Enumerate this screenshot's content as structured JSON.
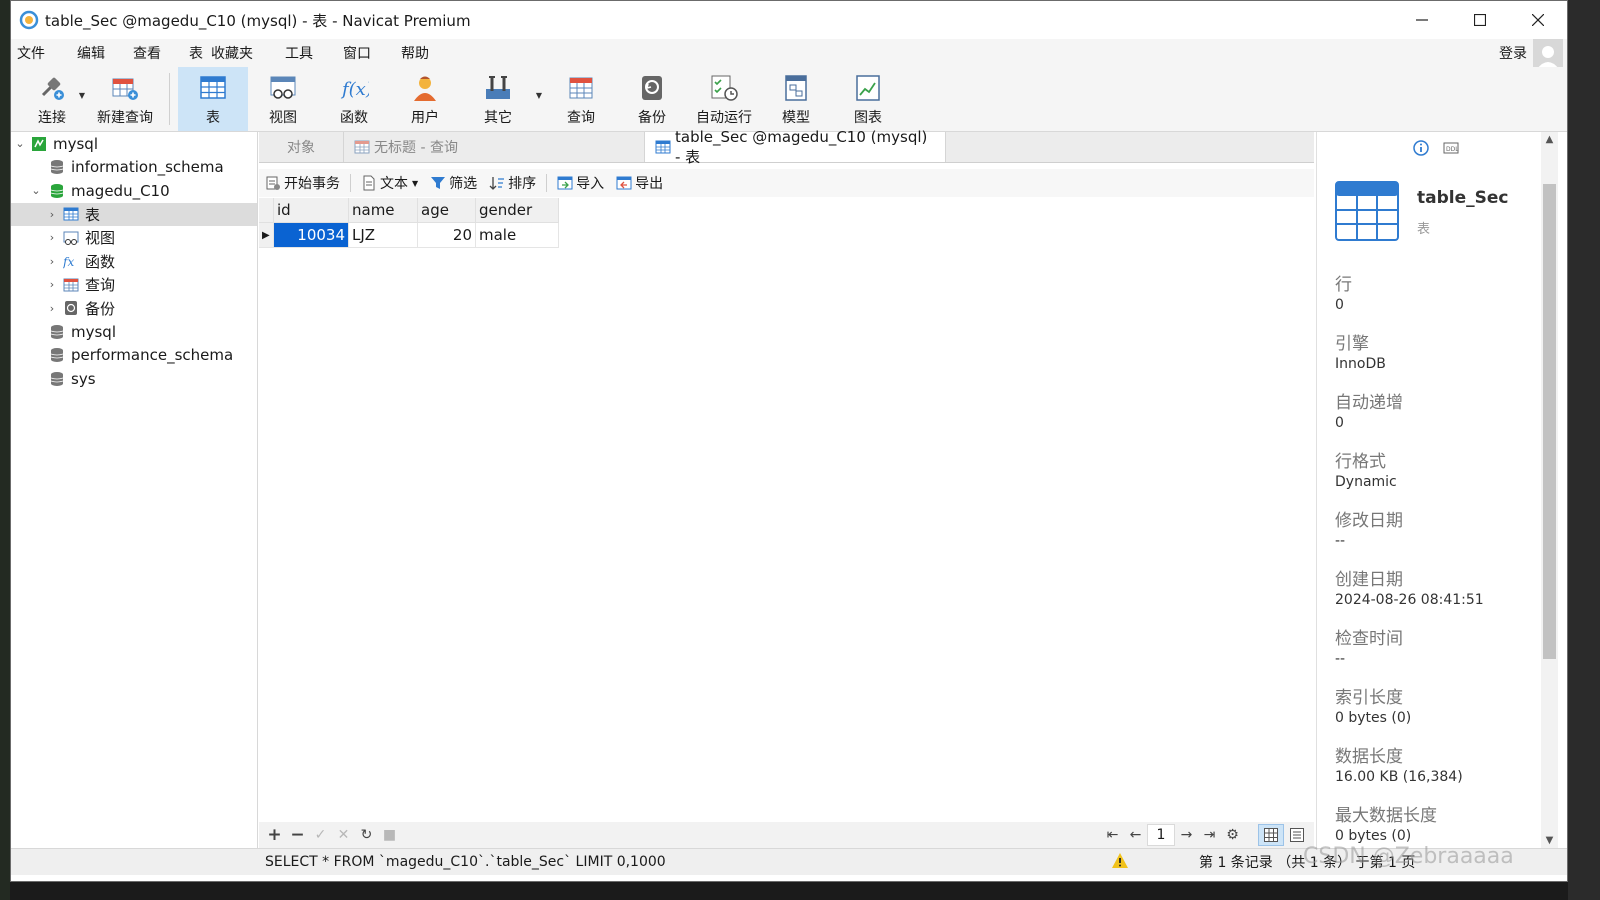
{
  "window": {
    "title": "table_Sec @magedu_C10 (mysql) - 表 - Navicat Premium"
  },
  "menu": [
    "文件",
    "编辑",
    "查看",
    "表",
    "收藏夹",
    "工具",
    "窗口",
    "帮助"
  ],
  "login_label": "登录",
  "toolbar": [
    {
      "label": "连接",
      "icon": "connection-icon"
    },
    {
      "label": "新建查询",
      "icon": "new-query-icon"
    },
    {
      "label": "表",
      "icon": "table-icon"
    },
    {
      "label": "视图",
      "icon": "view-icon"
    },
    {
      "label": "函数",
      "icon": "function-icon"
    },
    {
      "label": "用户",
      "icon": "user-icon"
    },
    {
      "label": "其它",
      "icon": "tools-icon"
    },
    {
      "label": "查询",
      "icon": "query-icon"
    },
    {
      "label": "备份",
      "icon": "backup-icon"
    },
    {
      "label": "自动运行",
      "icon": "automation-icon"
    },
    {
      "label": "模型",
      "icon": "model-icon"
    },
    {
      "label": "图表",
      "icon": "chart-icon"
    }
  ],
  "tree": {
    "connection": "mysql",
    "databases": {
      "information_schema": "information_schema",
      "magedu": "magedu_C10",
      "mysql": "mysql",
      "performance_schema": "performance_schema",
      "sys": "sys"
    },
    "children": {
      "tables": "表",
      "views": "视图",
      "functions": "函数",
      "queries": "查询",
      "backups": "备份"
    }
  },
  "tabs": {
    "objects": "对象",
    "query": "无标题 - 查询",
    "table": "table_Sec @magedu_C10 (mysql) - 表"
  },
  "data_toolbar": {
    "begin_transaction": "开始事务",
    "text": "文本",
    "filter": "筛选",
    "sort": "排序",
    "import": "导入",
    "export": "导出"
  },
  "grid": {
    "columns": [
      "id",
      "name",
      "age",
      "gender"
    ],
    "rows": [
      {
        "id": "10034",
        "name": "LJZ",
        "age": "20",
        "gender": "male"
      }
    ]
  },
  "pagination": {
    "page": "1"
  },
  "status": {
    "sql": "SELECT * FROM `magedu_C10`.`table_Sec` LIMIT 0,1000",
    "records": "第 1 条记录 （共 1 条） 于第 1 页"
  },
  "info_panel": {
    "name": "table_Sec",
    "type": "表",
    "properties": [
      {
        "label": "行",
        "value": "0"
      },
      {
        "label": "引擎",
        "value": "InnoDB"
      },
      {
        "label": "自动递增",
        "value": "0"
      },
      {
        "label": "行格式",
        "value": "Dynamic"
      },
      {
        "label": "修改日期",
        "value": "--"
      },
      {
        "label": "创建日期",
        "value": "2024-08-26 08:41:51"
      },
      {
        "label": "检查时间",
        "value": "--"
      },
      {
        "label": "索引长度",
        "value": "0 bytes (0)"
      },
      {
        "label": "数据长度",
        "value": "16.00 KB (16,384)"
      },
      {
        "label": "最大数据长度",
        "value": "0 bytes (0)"
      }
    ]
  },
  "watermark": "CSDN @Zebraaaaa",
  "colors": {
    "selection": "#0a63d2",
    "active_tool": "#cde4f7",
    "db_green": "#2aa53b"
  }
}
